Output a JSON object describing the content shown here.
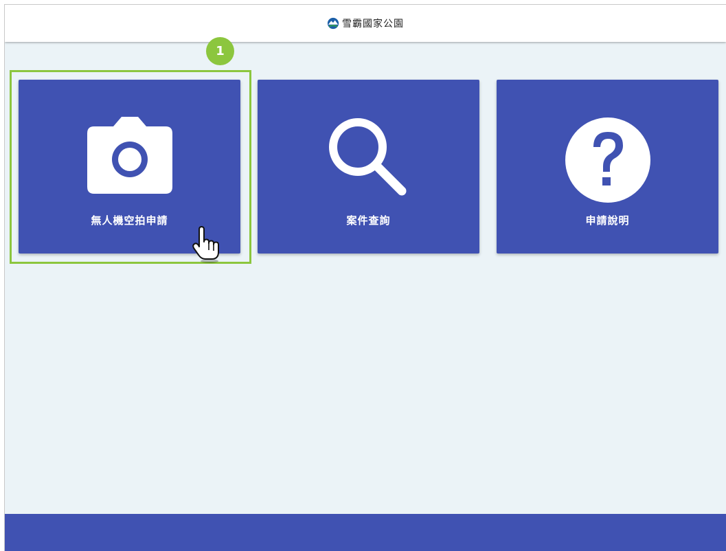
{
  "header": {
    "brand_name": "雪霸國家公園",
    "logo_icon": "park-emblem-icon"
  },
  "cards": [
    {
      "label": "無人機空拍申請",
      "icon": "camera-icon"
    },
    {
      "label": "案件查詢",
      "icon": "search-icon"
    },
    {
      "label": "申請說明",
      "icon": "question-icon"
    }
  ],
  "annotation": {
    "step_number": "1",
    "highlight_color": "#8cc63e",
    "cursor_icon": "hand-pointer-icon"
  },
  "colors": {
    "primary": "#4052b2",
    "background": "#ebf3f7",
    "header": "#ffffff"
  }
}
